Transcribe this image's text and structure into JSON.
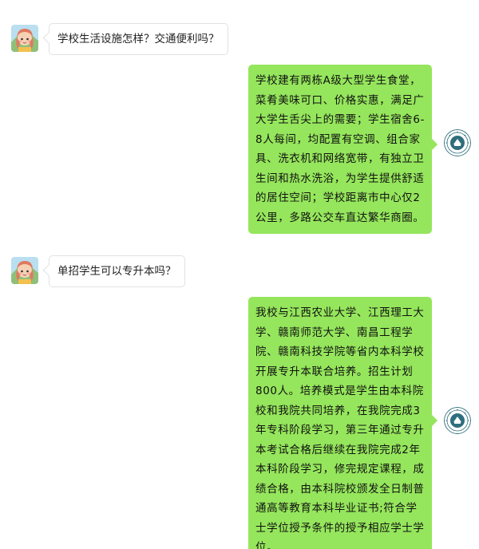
{
  "conversation": [
    {
      "side": "left",
      "sender_avatar": "girl-avatar",
      "text": "学校生活设施怎样？交通便利吗？"
    },
    {
      "side": "right",
      "sender_avatar": "school-logo",
      "lines": [
        "学校建有两栋A级大型学生食堂，",
        "菜肴美味可口、价格实惠，满足广",
        "大学生舌尖上的需要；学生宿舍6-",
        "8人每间，均配置有空调、组合家",
        "具、洗衣机和网络宽带，有独立卫",
        "生间和热水洗浴，为学生提供舒适",
        "的居住空间；学校距离市中心仅2",
        "公里，多路公交车直达繁华商圈。"
      ]
    },
    {
      "side": "left",
      "sender_avatar": "girl-avatar",
      "text": "单招学生可以专升本吗？"
    },
    {
      "side": "right",
      "sender_avatar": "school-logo",
      "lines": [
        "我校与江西农业大学、江西理工大",
        "学、赣南师范大学、南昌工程学",
        "院、赣南科技学院等省内本科学校",
        "开展专升本联合培养。招生计划",
        "800人。培养模式是学生由本科院",
        "校和我院共同培养，在我院完成3",
        "年专科阶段学习，第三年通过专升",
        "本考试合格后继续在我院完成2年",
        "本科阶段学习，修完规定课程，成",
        "绩合格，由本科院校颁发全日制普",
        "通高等教育本科毕业证书;符合学",
        "士学位授予条件的授予相应学士学",
        "位。"
      ]
    }
  ],
  "colors": {
    "outgoing_bubble": "#95e65c",
    "incoming_bubble": "#ffffff",
    "school_logo": "#2f6e7c"
  }
}
